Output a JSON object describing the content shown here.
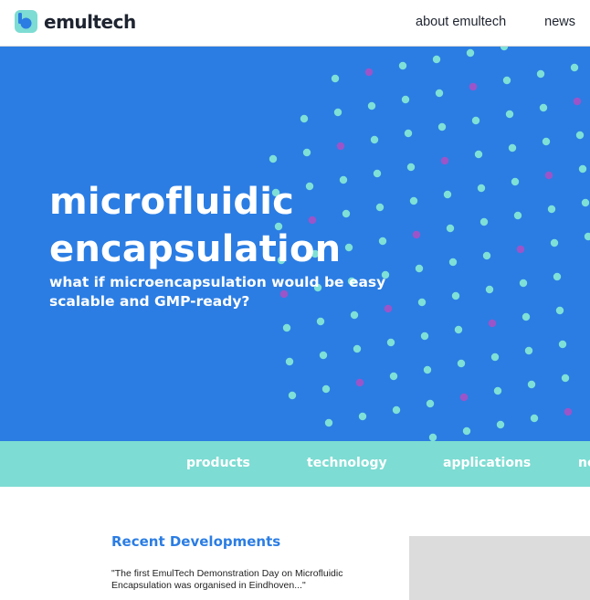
{
  "header": {
    "logo_text": "emultech",
    "nav": [
      {
        "label": "about emultech"
      },
      {
        "label": "news"
      }
    ]
  },
  "hero": {
    "title_line1": "microfluidic",
    "title_line2": "encapsulation",
    "subtitle": "what if microencapsulation would be easy scalable and GMP-ready?",
    "colors": {
      "background": "#2b7de3",
      "dot_cyan": "#7ee0d6",
      "dot_purple": "#9b55c9"
    }
  },
  "subnav": {
    "items": [
      {
        "label": "products"
      },
      {
        "label": "technology"
      },
      {
        "label": "applications"
      },
      {
        "label": "ne"
      }
    ]
  },
  "content": {
    "section_title": "Recent Developments",
    "excerpt": "\"The first EmulTech Demonstration Day on Microfluidic Encapsulation was organised in Eindhoven...\""
  },
  "colors": {
    "accent": "#2b7de3",
    "teal": "#7ddcd3"
  }
}
